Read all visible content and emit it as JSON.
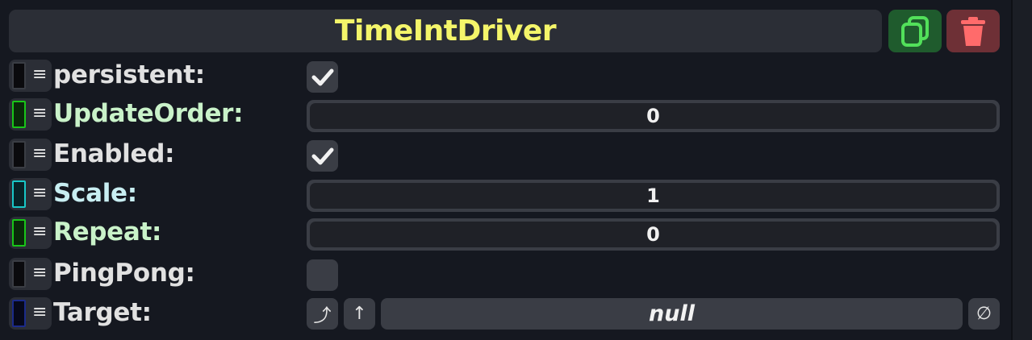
{
  "component": {
    "title": "TimeIntDriver",
    "title_color": "#f4f56a"
  },
  "colors": {
    "label_default": "#e1e1e1",
    "label_green": "#c9f2c9",
    "label_cyan": "#c8eef2",
    "handle_green": "#19c619",
    "handle_cyan": "#19c8c8",
    "handle_blue": "#1b2a8a",
    "duplicate_button": "#1f5b2d",
    "delete_button": "#6e3036"
  },
  "fields": {
    "persistent": {
      "label": "persistent:",
      "checked": true
    },
    "update_order": {
      "label": "UpdateOrder:",
      "value": "0"
    },
    "enabled": {
      "label": "Enabled:",
      "checked": true
    },
    "scale": {
      "label": "Scale:",
      "value": "1"
    },
    "repeat": {
      "label": "Repeat:",
      "value": "0"
    },
    "ping_pong": {
      "label": "PingPong:",
      "checked": false
    },
    "target": {
      "label": "Target:",
      "value": "null"
    }
  },
  "icons": {
    "drag_handle": "≡",
    "grab_ref": "⤴",
    "open_ref": "↑",
    "clear_ref": "∅",
    "duplicate": "duplicate-icon",
    "delete": "trash-icon"
  }
}
